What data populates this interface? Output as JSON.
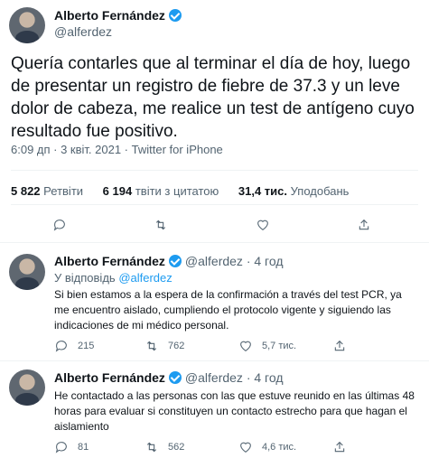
{
  "main_tweet": {
    "author": "Alberto Fernández",
    "handle": "@alferdez",
    "text": "Quería contarles que al terminar el día de hoy, luego de presentar un registro de fiebre de 37.3 y un leve dolor de cabeza, me realice un test de antígeno cuyo resultado fue positivo.",
    "meta": "6:09 дп · 3 квіт. 2021 · Twitter for iPhone",
    "stats": [
      {
        "value": "5 822",
        "label": "Ретвіти"
      },
      {
        "value": "6 194",
        "label": "твіти з цитатою"
      },
      {
        "value": "31,4 тис.",
        "label": "Уподобань"
      }
    ],
    "icons": [
      "reply-icon",
      "retweet-icon",
      "like-icon",
      "share-icon"
    ]
  },
  "replies": [
    {
      "author": "Alberto Fernández",
      "handle": "@alferdez",
      "time": "· 4 год",
      "reply_to_prefix": "У відповідь",
      "reply_to_handle": "@alferdez",
      "text": "Si bien estamos a la espera de la confirmación a través del test PCR, ya me encuentro aislado, cumpliendo el protocolo vigente y siguiendo las indicaciones de mi médico personal.",
      "reply_count": "215",
      "retweet_count": "762",
      "like_count": "5,7 тис."
    },
    {
      "author": "Alberto Fernández",
      "handle": "@alferdez",
      "time": "· 4 год",
      "text": "He contactado a las personas con las que estuve reunido en las últimas 48 horas para evaluar si constituyen un contacto estrecho para que hagan el aislamiento",
      "reply_count": "81",
      "retweet_count": "562",
      "like_count": "4,6 тис."
    }
  ],
  "colors": {
    "accent": "#1d9bf0",
    "text": "#0f1419",
    "muted": "#536471",
    "divider": "#eff3f4"
  }
}
